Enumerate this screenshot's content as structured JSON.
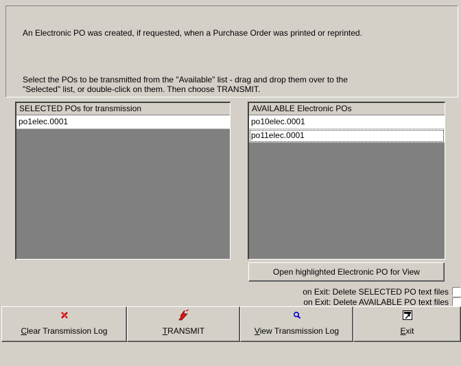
{
  "info": {
    "line1": "An Electronic PO was created, if requested, when a Purchase Order was printed or reprinted.",
    "line2": "Select the POs to be transmitted from the \"Available\" list - drag and drop them over to the",
    "line3": "\"Selected\" list, or double-click on them.  Then choose TRANSMIT."
  },
  "selected_list": {
    "header": "SELECTED POs for transmission",
    "items": [
      "po1elec.0001"
    ]
  },
  "available_list": {
    "header": "AVAILABLE  Electronic POs",
    "items": [
      "po10elec.0001",
      "po11elec.0001"
    ]
  },
  "open_button": {
    "label": "Open highlighted Electronic PO for View"
  },
  "checkboxes": {
    "delete_selected": "on Exit: Delete SELECTED PO text files",
    "delete_available": "on Exit: Delete AVAILABLE PO text files"
  },
  "toolbar": {
    "clear_log": {
      "key": "C",
      "rest": "lear Transmission Log",
      "icon": "clear-log-icon"
    },
    "transmit": {
      "key": "T",
      "rest": "RANSMIT",
      "icon": "transmit-icon"
    },
    "view_log": {
      "key": "V",
      "rest": "iew Transmission Log",
      "icon": "magnifier-icon"
    },
    "exit": {
      "key": "E",
      "rest": "xit",
      "icon": "exit-door-icon"
    }
  },
  "colors": {
    "dialog_bg": "#d4d0c8",
    "list_empty_bg": "#808080",
    "list_item_bg": "#ffffff",
    "clear_icon": "#cc0000",
    "transmit_icon": "#d81818",
    "view_icon": "#0000cc"
  }
}
